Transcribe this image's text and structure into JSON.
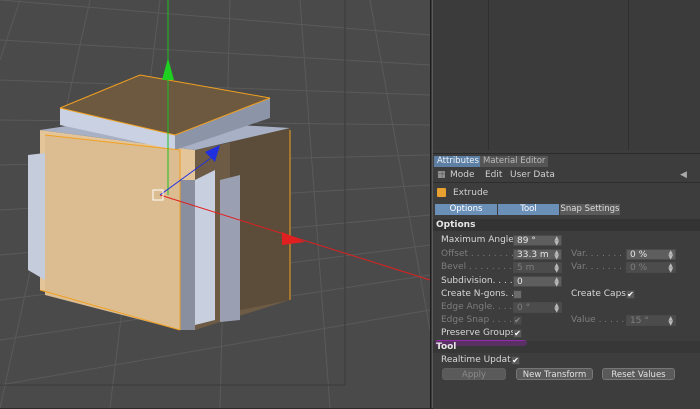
{
  "tabs": [
    {
      "label": "Attributes",
      "active": true
    },
    {
      "label": "Material Editor",
      "active": false
    }
  ],
  "menu": [
    "Mode",
    "Edit",
    "User Data"
  ],
  "object_name": "Extrude",
  "segments": [
    {
      "label": "Options",
      "on": true
    },
    {
      "label": "Tool",
      "on": true
    },
    {
      "label": "Snap Settings",
      "on": false
    }
  ],
  "sections": {
    "options": "Options",
    "tool": "Tool"
  },
  "options": {
    "max_angle_label": "Maximum Angle",
    "max_angle_value": "89 °",
    "offset_label": "Offset . . . . . . . . .",
    "offset_value": "33.3 m",
    "var1_label": "Var. . . . . . . . .",
    "var1_value": "0 %",
    "bevel_label": "Bevel . . . . . . . . .",
    "bevel_value": "5 m",
    "var2_label": "Var. . . . . . . . .",
    "var2_value": "0 %",
    "subdivision_label": "Subdivision. . . . .",
    "subdivision_value": "0",
    "create_ngons_label": "Create N-gons. .",
    "create_caps_label": "Create Caps",
    "create_caps_checked": "✔",
    "edge_angle_label": "Edge Angle. . . . .",
    "edge_angle_value": "0 °",
    "edge_snap_label": "Edge Snap . . . . .",
    "edge_snap_checked": "✔",
    "value_label": "Value . . . . . . .",
    "value_value": "15 °",
    "preserve_groups_label": "Preserve Groups",
    "preserve_groups_checked": "✔"
  },
  "tool": {
    "realtime_update_label": "Realtime Update",
    "realtime_update_checked": "✔",
    "apply_label": "Apply",
    "new_transform_label": "New Transform",
    "reset_values_label": "Reset Values"
  },
  "colors": {
    "accent_tab": "#5c7fa3",
    "segment_on": "#6a90b8",
    "highlight_stroke": "#9a29b8",
    "axis_x": "#e02020",
    "axis_y": "#20c020",
    "axis_z": "#2030e0",
    "selection_edge": "#f0a020"
  }
}
